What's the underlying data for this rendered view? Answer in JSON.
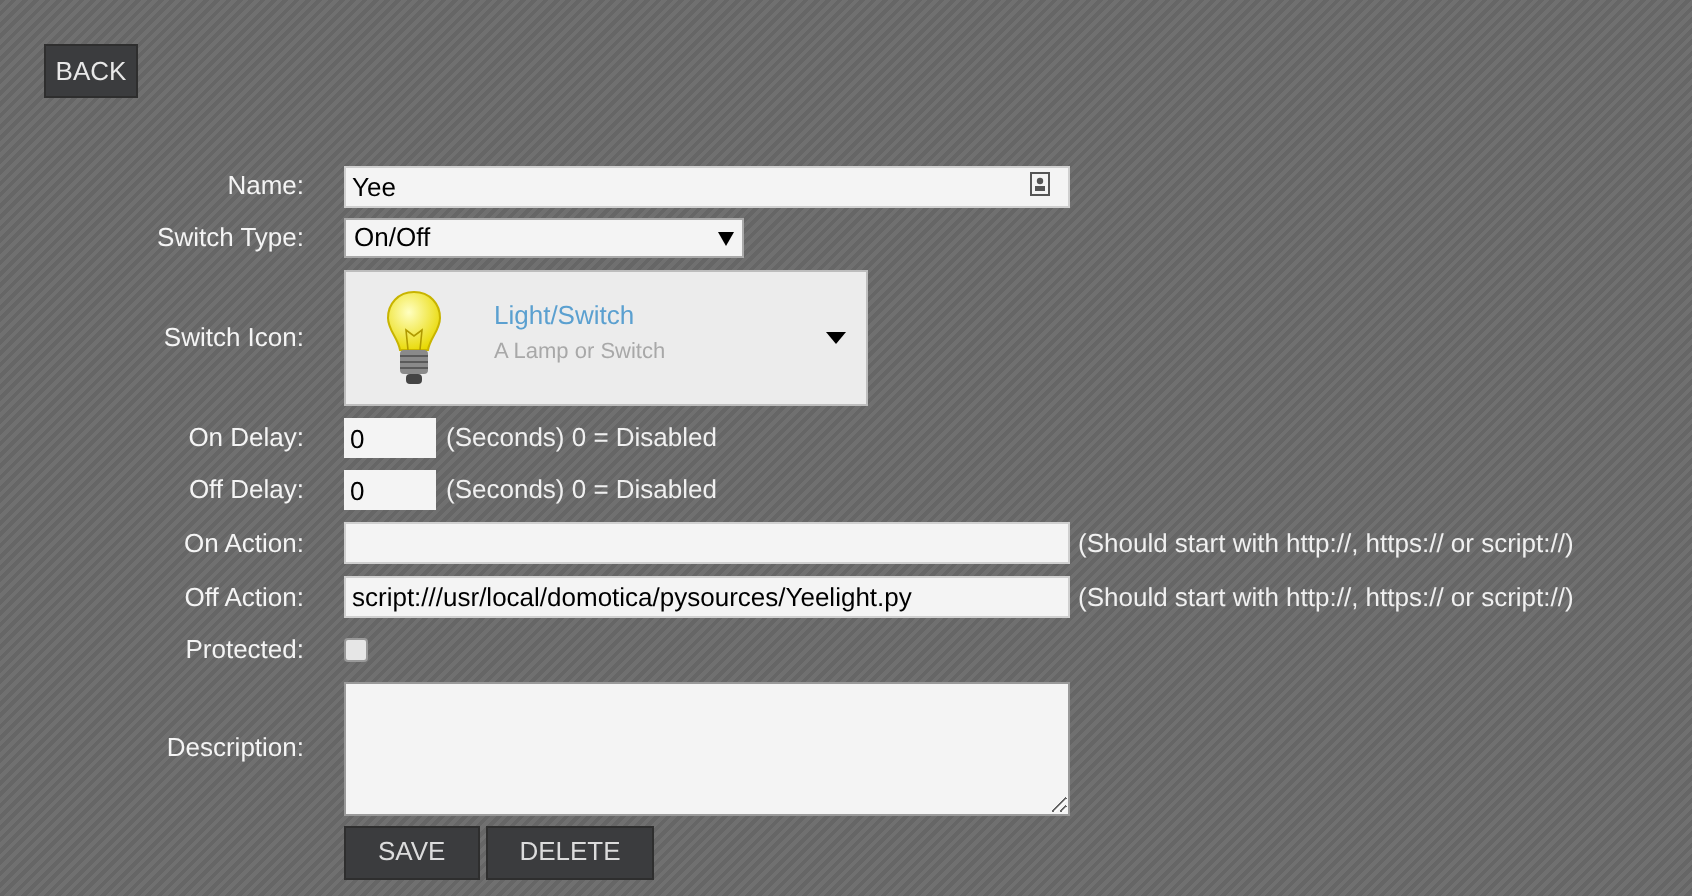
{
  "back_button": "BACK",
  "fields": [
    {
      "kind": "text",
      "label": "Name:",
      "value": "Yee"
    },
    {
      "kind": "select",
      "label": "Switch Type:",
      "value": "On/Off"
    },
    {
      "kind": "icon",
      "label": "Switch Icon:",
      "title": "Light/Switch",
      "subtitle": "A Lamp or Switch"
    },
    {
      "kind": "delay",
      "label": "On Delay:",
      "value": "0",
      "hint": "(Seconds) 0 = Disabled"
    },
    {
      "kind": "delay",
      "label": "Off Delay:",
      "value": "0",
      "hint": "(Seconds) 0 = Disabled"
    },
    {
      "kind": "action",
      "label": "On Action:",
      "hint": "(Should start with http://, https:// or script://)"
    },
    {
      "kind": "action",
      "label": "Off Action:",
      "value": "script:///usr/local/domotica/pysources/Yeelight.py",
      "hint": "(Should start with http://, https:// or script://)"
    },
    {
      "kind": "checkbox",
      "label": "Protected:",
      "checked": false
    },
    {
      "kind": "textarea",
      "label": "Description:"
    }
  ],
  "buttons": [
    "SAVE",
    "DELETE"
  ]
}
